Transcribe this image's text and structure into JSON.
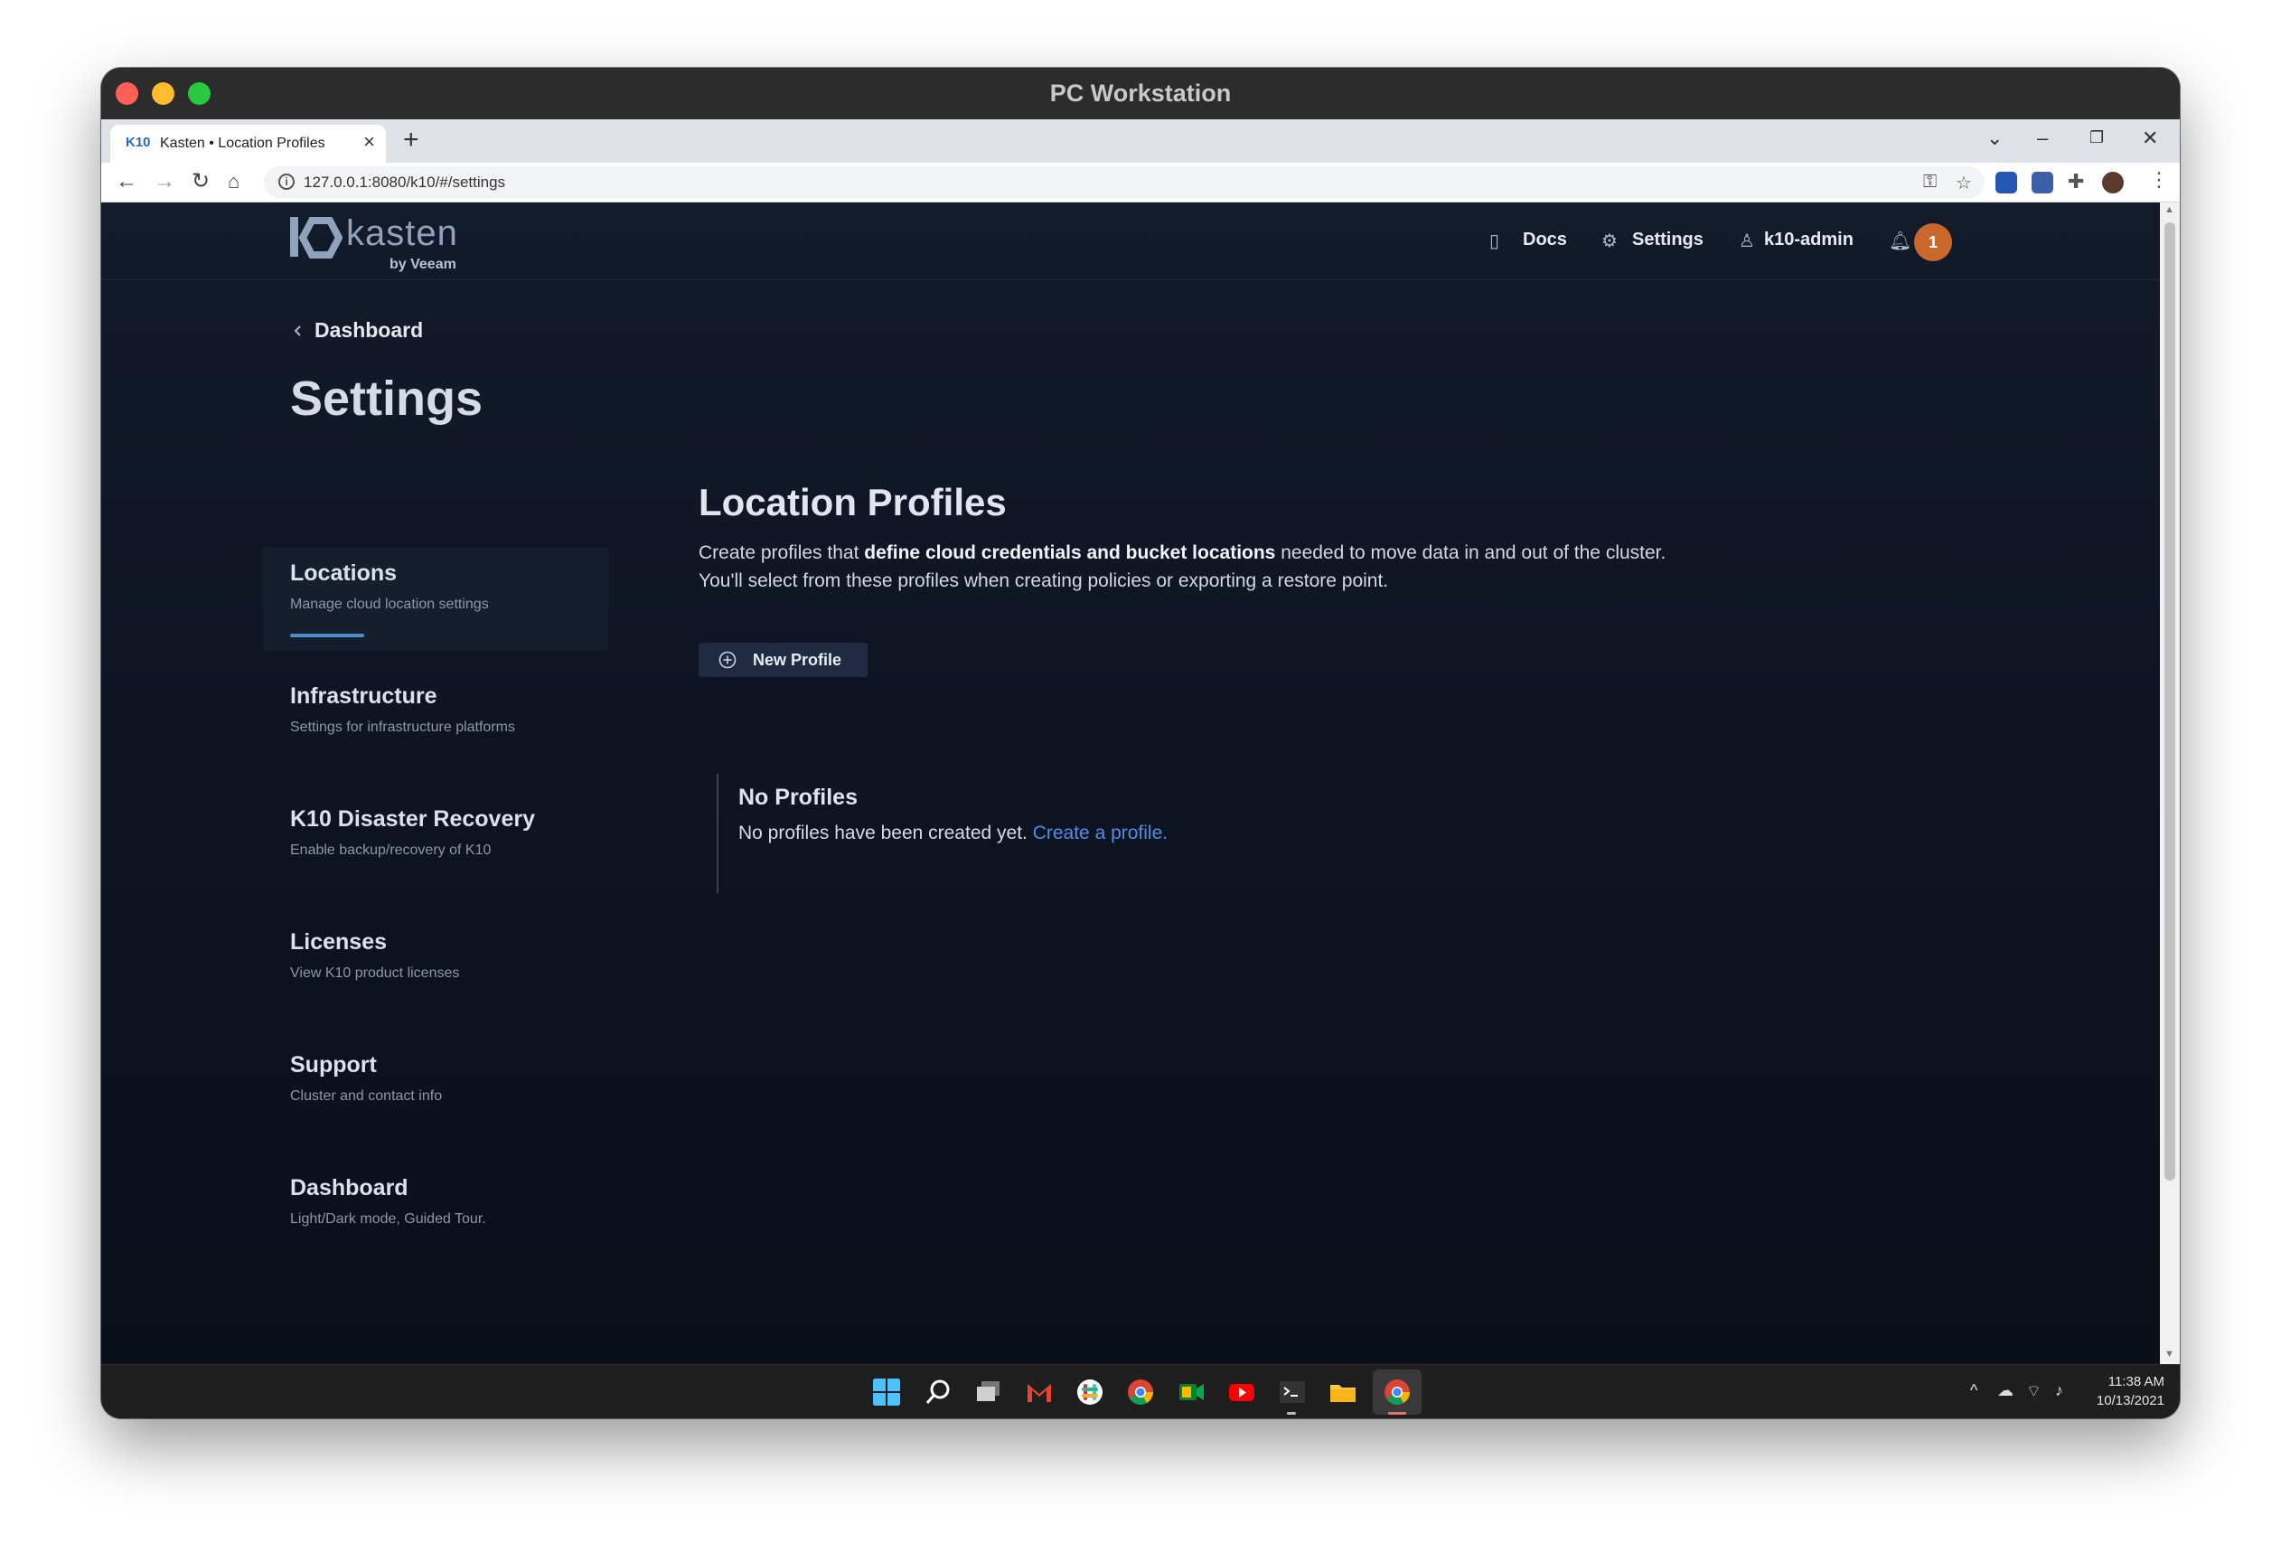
{
  "window": {
    "title": "PC Workstation"
  },
  "browser": {
    "tab_title": "Kasten • Location Profiles",
    "tab_favicon": "K10",
    "url": "127.0.0.1:8080/k10/#/settings"
  },
  "header": {
    "logo_word": "kasten",
    "logo_sub": "by Veeam",
    "nav": {
      "docs": "Docs",
      "settings": "Settings",
      "user": "k10-admin"
    },
    "notification_count": "1"
  },
  "breadcrumb": {
    "back_label": "Dashboard"
  },
  "page": {
    "title": "Settings"
  },
  "sidebar": {
    "items": [
      {
        "label": "Locations",
        "sub": "Manage cloud location settings"
      },
      {
        "label": "Infrastructure",
        "sub": "Settings for infrastructure platforms"
      },
      {
        "label": "K10 Disaster Recovery",
        "sub": "Enable backup/recovery of K10"
      },
      {
        "label": "Licenses",
        "sub": "View K10 product licenses"
      },
      {
        "label": "Support",
        "sub": "Cluster and contact info"
      },
      {
        "label": "Dashboard",
        "sub": "Light/Dark mode, Guided Tour."
      }
    ]
  },
  "section": {
    "title": "Location Profiles",
    "desc_before": "Create profiles that ",
    "desc_bold": "define cloud credentials and bucket locations",
    "desc_after": " needed to move data in and out of the cluster. You'll select from these profiles when creating policies or exporting a restore point.",
    "new_profile_label": "New Profile"
  },
  "empty_state": {
    "title": "No Profiles",
    "text": "No profiles have been created yet. ",
    "link": "Create a profile."
  },
  "taskbar": {
    "time": "11:38 AM",
    "date": "10/13/2021"
  },
  "colors": {
    "accent": "#4a90c8",
    "badge": "#c9682c",
    "link": "#4f8fe6",
    "background": "#0e1422"
  }
}
